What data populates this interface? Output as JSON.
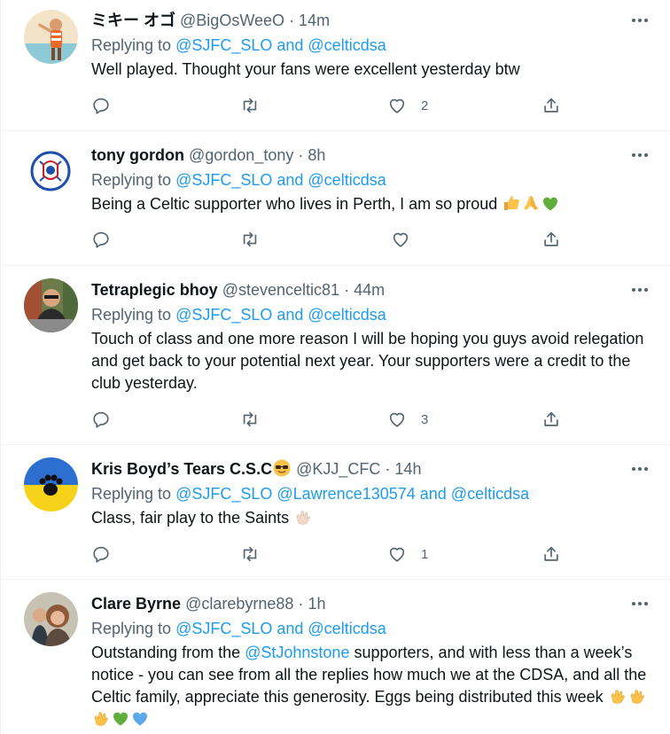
{
  "tweets": [
    {
      "name": "ミキー オゴ",
      "handle": "@BigOsWeeO",
      "time": "14m",
      "replying_prefix": "Replying to",
      "replying_to": "@SJFC_SLO and @celticdsa",
      "text": "Well played. Thought your fans were excellent yesterday btw",
      "likes": "2"
    },
    {
      "name": "tony gordon",
      "handle": "@gordon_tony",
      "time": "8h",
      "replying_prefix": "Replying to",
      "replying_to": "@SJFC_SLO and @celticdsa",
      "text": "Being a Celtic supporter who lives in Perth, I am so proud",
      "emojis": [
        "thumbs-up-emoji",
        "folded-hands-emoji",
        "green-heart-emoji"
      ],
      "likes": ""
    },
    {
      "name": "Tetraplegic bhoy",
      "handle": "@stevenceltic81",
      "time": "44m",
      "replying_prefix": "Replying to",
      "replying_to": "@SJFC_SLO and @celticdsa",
      "text": "Touch of class and one more reason I will be hoping you guys avoid relegation and get back to your potential next year. Your supporters were a credit to the club yesterday.",
      "likes": "3"
    },
    {
      "name": "Kris Boyd’s Tears C.S.C",
      "name_emoji": "smiling-face-with-sunglasses-emoji",
      "handle": "@KJJ_CFC",
      "time": "14h",
      "replying_prefix": "Replying to",
      "replying_to": "@SJFC_SLO @Lawrence130574 and @celticdsa",
      "text": "Class, fair play to the Saints",
      "emojis": [
        "clapping-hands-emoji"
      ],
      "likes": "1"
    },
    {
      "name": "Clare Byrne",
      "handle": "@clarebyrne88",
      "time": "1h",
      "replying_prefix": "Replying to",
      "replying_to": "@SJFC_SLO and @celticdsa",
      "text_part1": "Outstanding from the",
      "text_mention": "@StJohnstone",
      "text_part2": "supporters, and with less than a week’s notice - you can see from all the replies how much we at the CDSA, and all the Celtic family, appreciate this generosity. Eggs being distributed this week",
      "emojis": [
        "clapping-hands-emoji",
        "clapping-hands-emoji",
        "clapping-hands-emoji",
        "green-heart-emoji",
        "blue-heart-emoji"
      ]
    }
  ],
  "separator": "·",
  "colors": {
    "link": "#1d9bf0",
    "secondary": "#536471",
    "text": "#0f1419",
    "border": "#eff3f4"
  },
  "icons": {
    "reply": "reply-icon",
    "retweet": "retweet-icon",
    "like": "like-icon",
    "share": "share-icon",
    "more": "more-icon"
  }
}
